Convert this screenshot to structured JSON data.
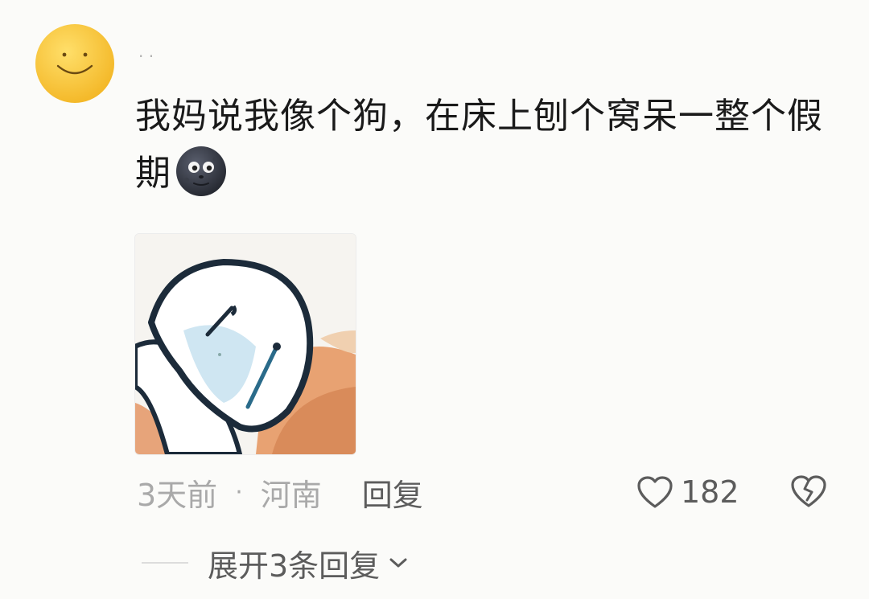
{
  "comment": {
    "username": "· ·",
    "text": "我妈说我像个狗，在床上刨个窝呆一整个假期",
    "emoji_icon": "new-moon-face-icon",
    "time": "3天前",
    "separator": "·",
    "location": "河南",
    "reply_label": "回复",
    "like_count": "182",
    "like_icon": "heart-outline-icon",
    "dislike_icon": "broken-heart-icon",
    "expand_label": "展开3条回复",
    "expand_icon": "chevron-down-icon"
  },
  "colors": {
    "avatar": "#f8c63a",
    "text": "#1a1a1a",
    "muted": "#a9a9a9",
    "action": "#5c5c5c"
  }
}
